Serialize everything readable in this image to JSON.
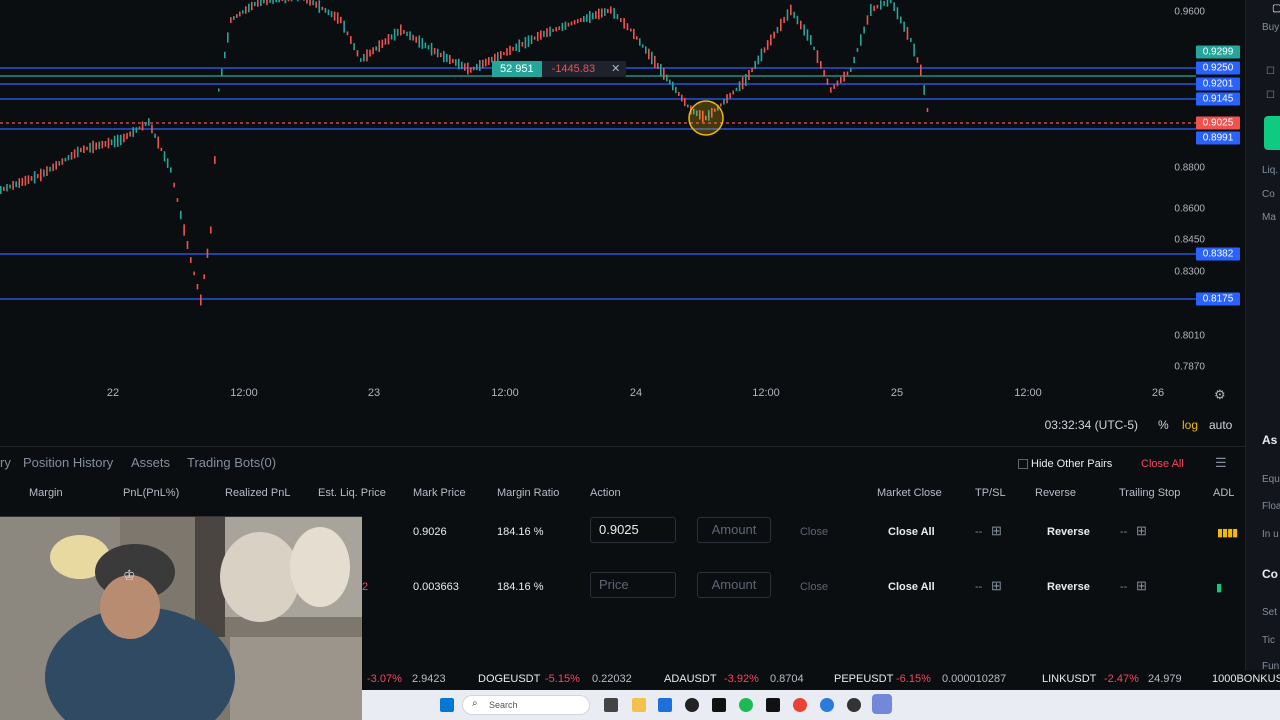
{
  "chart": {
    "price_levels": [
      "0.9600",
      "0.8800",
      "0.8600",
      "0.8450",
      "0.8300",
      "0.8010",
      "0.7870"
    ],
    "price_tags": [
      {
        "value": "0.9299",
        "color": "#26a69a"
      },
      {
        "value": "0.9250",
        "color": "#2962ff"
      },
      {
        "value": "0.9201",
        "color": "#2962ff"
      },
      {
        "value": "0.9145",
        "color": "#2962ff"
      },
      {
        "value": "0.9025",
        "color": "#ef5350"
      },
      {
        "value": "0.8991",
        "color": "#2962ff"
      },
      {
        "value": "0.8382",
        "color": "#2962ff"
      },
      {
        "value": "0.8175",
        "color": "#2962ff"
      }
    ],
    "time_labels": [
      "22",
      "12:00",
      "23",
      "12:00",
      "24",
      "12:00",
      "25",
      "12:00",
      "26"
    ],
    "order_badge": {
      "qty": "52 951",
      "pnl": "-1445.83",
      "close": "✕"
    },
    "clock": "03:32:34 (UTC-5)",
    "axis_options": [
      "%",
      "log",
      "auto"
    ],
    "colors": {
      "up": "#26a69a",
      "down": "#ef5350",
      "line": "#2962ff",
      "accent": "#f0b90b"
    }
  },
  "panel": {
    "tabs": [
      "ry",
      "Position History",
      "Assets",
      "Trading Bots(0)"
    ],
    "hide_other_pairs": "Hide Other Pairs",
    "close_all_top": "Close All",
    "headers": [
      "Margin",
      "PnL(PnL%)",
      "Realized PnL",
      "Est. Liq. Price",
      "Mark Price",
      "Margin Ratio",
      "Action",
      "Market Close",
      "TP/SL",
      "Reverse",
      "Trailing Stop",
      "ADL"
    ],
    "rows": [
      {
        "mark_price": "0.9026",
        "margin_ratio": "184.16 %",
        "price_input": "0.9025",
        "amount_placeholder": "Amount",
        "close": "Close",
        "close_all": "Close All",
        "tpsl": "--",
        "reverse": "Reverse",
        "trailing": "--"
      },
      {
        "mark_price": "0.003663",
        "margin_ratio": "184.16 %",
        "price_placeholder": "Price",
        "amount_placeholder": "Amount",
        "close": "Close",
        "close_all": "Close All",
        "tpsl": "--",
        "reverse": "Reverse",
        "trailing": "--",
        "edge_char": "2"
      }
    ]
  },
  "sidebar": {
    "items": [
      "Buy",
      "Liq.",
      "Co",
      "Ma",
      "As",
      "Equ",
      "Floa",
      "In u",
      "Co",
      "Set",
      "Tic",
      "Fun"
    ]
  },
  "ticker": [
    {
      "change": "-3.07%",
      "price": "2.9423"
    },
    {
      "symbol": "DOGEUSDT",
      "change": "-5.15%",
      "price": "0.22032"
    },
    {
      "symbol": "ADAUSDT",
      "change": "-3.92%",
      "price": "0.8704"
    },
    {
      "symbol": "PEPEUSDT",
      "change": "-6.15%",
      "price": "0.000010287"
    },
    {
      "symbol": "LINKUSDT",
      "change": "-2.47%",
      "price": "24.979"
    },
    {
      "symbol": "1000BONKUS"
    }
  ],
  "taskbar": {
    "search_placeholder": "Search"
  }
}
